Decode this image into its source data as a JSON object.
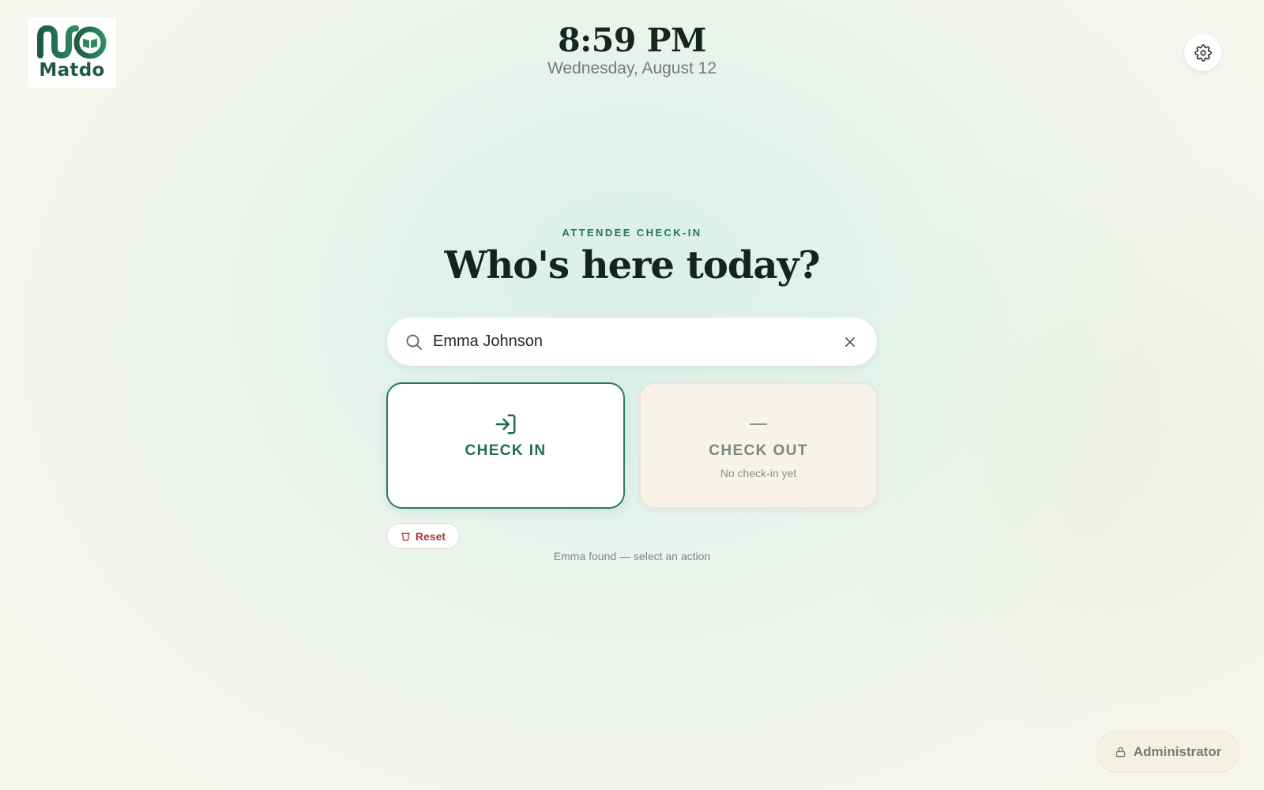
{
  "brand": {
    "name": "Matdo",
    "primary_color": "#1f5a45",
    "accent_color": "#2a7a62"
  },
  "clock": {
    "time": "8:59 PM",
    "date": "Wednesday, August 12"
  },
  "settings": {
    "icon": "gear-icon"
  },
  "hero": {
    "eyebrow": "ATTENDEE CHECK-IN",
    "title": "Who's here today?"
  },
  "search": {
    "value": "Emma Johnson",
    "icon": "search-icon",
    "clear_icon": "close-icon"
  },
  "actions": {
    "check_in": {
      "label": "CHECK IN",
      "icon": "log-in-icon"
    },
    "check_out": {
      "label": "CHECK OUT",
      "subtitle": "No check-in yet",
      "icon": "dash-icon"
    }
  },
  "reset": {
    "label": "Reset",
    "icon": "trash-icon",
    "color": "#a83a3a"
  },
  "status": {
    "message": "Emma found — select an action"
  },
  "admin": {
    "label": "Administrator",
    "icon": "lock-icon"
  }
}
